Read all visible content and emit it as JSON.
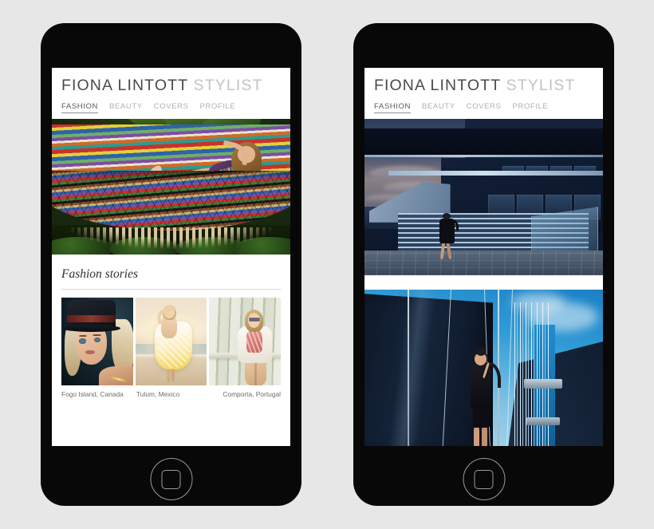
{
  "page": {
    "background_color": "#e7e7e8",
    "device_count": 2
  },
  "brand": {
    "name": "FIONA LINTOTT",
    "role": "STYLIST",
    "name_color": "#4a4a4a",
    "role_color": "#c3c3c3"
  },
  "nav": {
    "items": [
      {
        "label": "FASHION",
        "active": true
      },
      {
        "label": "BEAUTY",
        "active": false
      },
      {
        "label": "COVERS",
        "active": false
      },
      {
        "label": "PROFILE",
        "active": false
      }
    ],
    "active_color": "#5a5a5a",
    "inactive_color": "#b0b0b0"
  },
  "left_phone": {
    "hero": {
      "alt": "woman reclining in a colourful striped hammock with tropical foliage"
    },
    "section": {
      "title": "Fashion stories"
    },
    "stories": [
      {
        "caption": "Fogo Island, Canada",
        "alt": "blonde woman wearing a dark top hat"
      },
      {
        "caption": "Tulum, Mexico",
        "alt": "woman in a yellow and white dress on a sunlit beach"
      },
      {
        "caption": "Comporta, Portugal",
        "alt": "woman in sunglasses seated against pale wooden slats"
      }
    ]
  },
  "right_phone": {
    "images": [
      {
        "alt": "woman in black walking on steps of a blue modernist building at dusk"
      },
      {
        "alt": "woman in black leaning against a dark ship hull under blue sky"
      }
    ]
  },
  "home_button": {
    "icon": "rounded-square",
    "border_color": "#9a9a9a"
  }
}
